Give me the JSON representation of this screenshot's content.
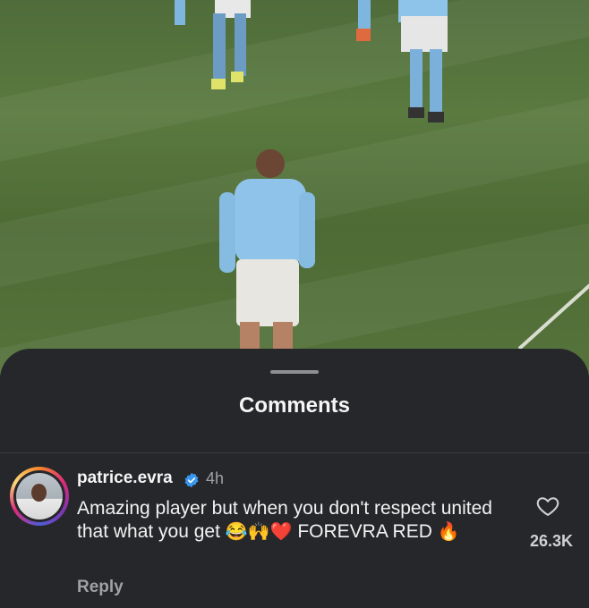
{
  "comments_sheet": {
    "title": "Comments"
  },
  "comment": {
    "username": "patrice.evra",
    "time": "4h",
    "text_part1": "Amazing player but when you don't respect united that what you get ",
    "emojis_1": "😂🙌❤️",
    "text_part2": " FOREVRA RED ",
    "emojis_2": "🔥",
    "likes": "26.3K",
    "reply_label": "Reply"
  },
  "colors": {
    "sheet_bg": "#26272b",
    "verified_blue": "#3897f0"
  }
}
